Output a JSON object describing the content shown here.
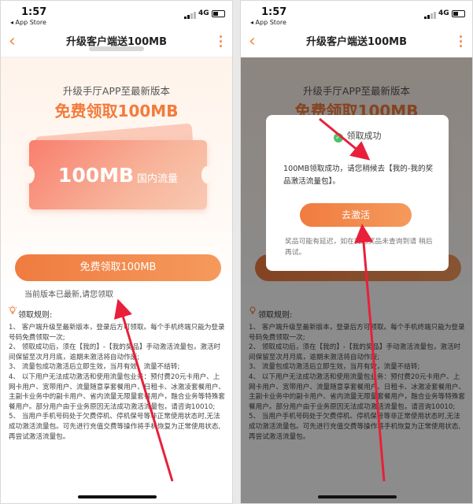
{
  "status": {
    "time": "1:57",
    "back_app": "◂ App Store",
    "network": "4G"
  },
  "nav": {
    "back_icon": "‹",
    "title": "升级客户端送100MB"
  },
  "hero": {
    "line1": "升级手厅APP至最新版本",
    "line2": "免费领取100MB",
    "ticket_amount": "100MB",
    "ticket_type": "国内流量"
  },
  "main_button": "免费领取100MB",
  "hint": "当前版本已最新,请您领取",
  "rules": {
    "title": "领取规则:",
    "items": [
      "1、 客户端升级至最新版本，登录后方可领取。每个手机终端只能为登录号码免费领取一次;",
      "2、 领取成功后，须在【我的】-【我的奖品】手动激活流量包，激活时间保留至次月月底，逾期未激活将自动作废;",
      "3、 流量包成功激活后立即生效，当月有效，流量不结转;",
      "4、 以下用户无法成功激活和使用流量包业务：预付费20元卡用户、上网卡用户、宽带用户、流量随意享套餐用户、日租卡、冰激凌套餐用户、主副卡业务中的副卡用户、省内流量无限量套餐用户，融合业务等特殊套餐用户。部分用户由于业务原因无法成功激活流量包，请咨询10010;",
      "5、 当用户手机号码处于欠费停机、停机保号等非正常使用状态时,无法成功激活流量包。可先进行充值交费等操作将手机恢复为正常使用状态,再尝试激活流量包。"
    ]
  },
  "dialog": {
    "title": "领取成功",
    "message": "100MB领取成功，请您稍候去【我的-我的奖品激活流量包】。",
    "button": "去激活",
    "note": "奖品可能有延迟，如在我的奖品未查询到请 稍后再试。"
  },
  "colors": {
    "accent": "#f27b3c",
    "arrow": "#e8203a",
    "success": "#4cc36b"
  }
}
